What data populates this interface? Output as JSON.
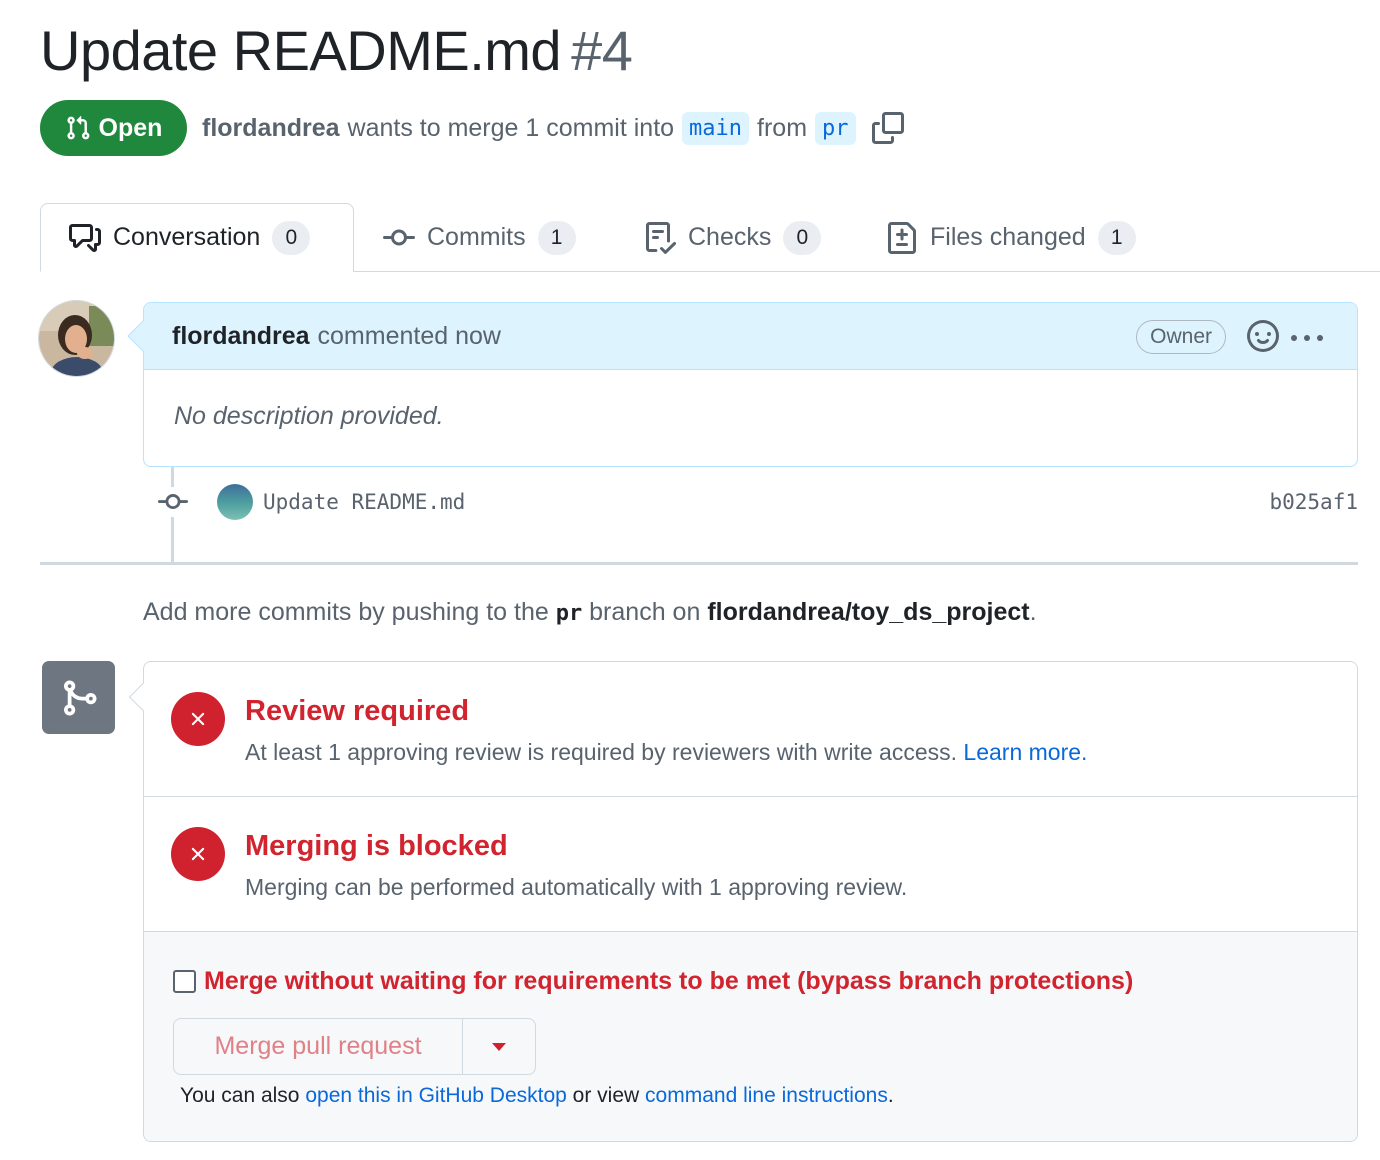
{
  "pr": {
    "title": "Update README.md",
    "number": "#4",
    "state": "Open",
    "author": "flordandrea",
    "merge_text": "wants to merge 1 commit into",
    "base_branch": "main",
    "from_text": "from",
    "head_branch": "pr"
  },
  "tabs": [
    {
      "label": "Conversation",
      "count": "0",
      "icon": "comment-discussion-icon"
    },
    {
      "label": "Commits",
      "count": "1",
      "icon": "git-commit-icon"
    },
    {
      "label": "Checks",
      "count": "0",
      "icon": "checklist-icon"
    },
    {
      "label": "Files changed",
      "count": "1",
      "icon": "file-diff-icon"
    }
  ],
  "comment": {
    "author": "flordandrea",
    "action": "commented now",
    "role_badge": "Owner",
    "body": "No description provided."
  },
  "commit": {
    "message": "Update README.md",
    "sha": "b025af1"
  },
  "push_note": {
    "prefix": "Add more commits by pushing to the",
    "branch": "pr",
    "middle": "branch on",
    "repo": "flordandrea/toy_ds_project",
    "suffix": "."
  },
  "merge": {
    "review_title": "Review required",
    "review_desc": "At least 1 approving review is required by reviewers with write access.",
    "review_link": "Learn more.",
    "blocked_title": "Merging is blocked",
    "blocked_desc": "Merging can be performed automatically with 1 approving review.",
    "bypass_label": "Merge without waiting for requirements to be met (bypass branch protections)",
    "bypass_checked": false,
    "merge_button": "Merge pull request",
    "also_prefix": "You can also",
    "desktop_link": "open this in GitHub Desktop",
    "or_text": "or view",
    "cli_link": "command line instructions",
    "also_suffix": "."
  },
  "colors": {
    "open_green": "#1f883d",
    "danger_red": "#d1242f",
    "link_blue": "#0969da",
    "comment_header_bg": "#ddf4ff"
  }
}
